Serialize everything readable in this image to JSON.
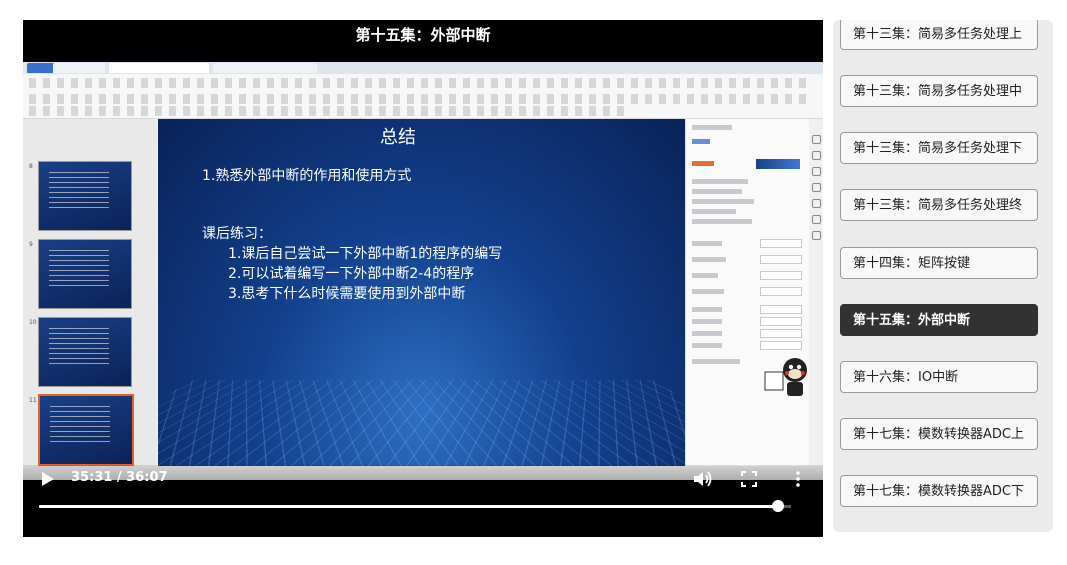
{
  "player": {
    "title": "第十五集：外部中断",
    "time": "35:31 / 36:07",
    "progress": 0.983
  },
  "slide": {
    "title": "总结",
    "lines": [
      "1.熟悉外部中断的作用和使用方式",
      "课后练习：",
      "1.课后自己尝试一下外部中断1的程序的编写",
      "2.可以试着编写一下外部中断2-4的程序",
      "3.思考下什么时候需要使用到外部中断"
    ]
  },
  "playlist": {
    "items": [
      "第十三集：简易多任务处理上",
      "第十三集：简易多任务处理中",
      "第十三集：简易多任务处理下",
      "第十三集：简易多任务处理终",
      "第十四集：矩阵按键",
      "第十五集：外部中断",
      "第十六集：IO中断",
      "第十七集：模数转换器ADC上",
      "第十七集：模数转换器ADC下"
    ],
    "active_index": 5
  }
}
